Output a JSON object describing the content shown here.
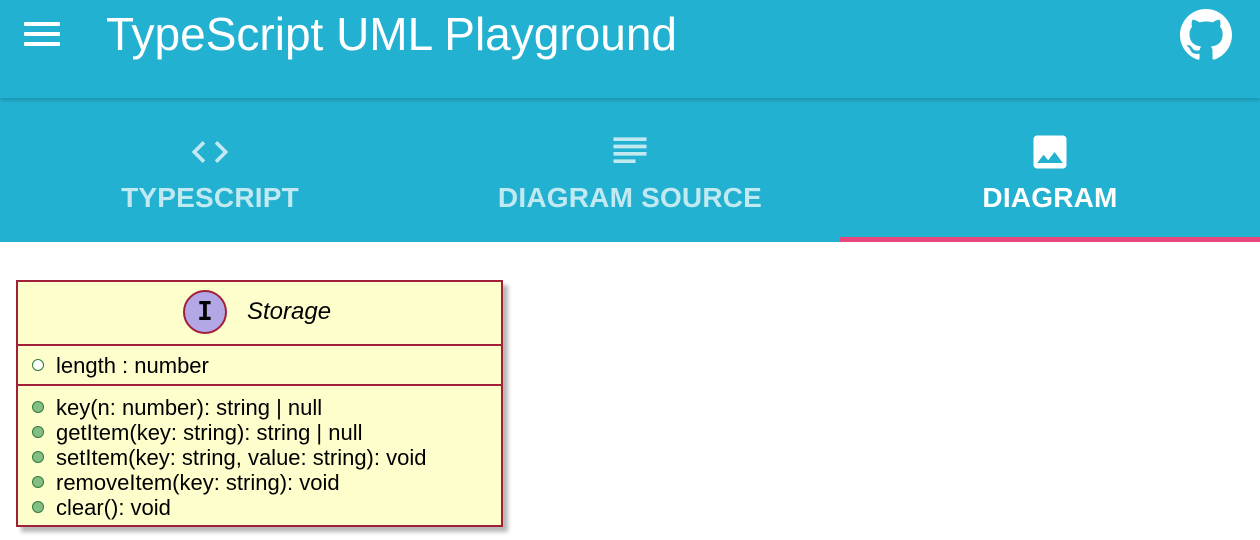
{
  "app": {
    "title": "TypeScript UML Playground",
    "menu_icon": "hamburger-menu-icon",
    "github_icon": "github-icon",
    "accent_color": "#22b1d0",
    "indicator_color": "#e8477d"
  },
  "tabs": [
    {
      "label": "TYPESCRIPT",
      "icon": "code-icon",
      "active": false
    },
    {
      "label": "DIAGRAM SOURCE",
      "icon": "notes-icon",
      "active": false
    },
    {
      "label": "DIAGRAM",
      "icon": "image-icon",
      "active": true
    }
  ],
  "diagram": {
    "class_name": "Storage",
    "stereotype_letter": "I",
    "box_fill": "#fefecd",
    "box_border": "#a0203a",
    "fields": [
      {
        "text": "length : number",
        "marker": "hollow-circle"
      }
    ],
    "methods": [
      {
        "text": "key(n: number): string | null",
        "marker": "filled-circle"
      },
      {
        "text": "getItem(key: string): string | null",
        "marker": "filled-circle"
      },
      {
        "text": "setItem(key: string, value: string): void",
        "marker": "filled-circle"
      },
      {
        "text": "removeItem(key: string): void",
        "marker": "filled-circle"
      },
      {
        "text": "clear(): void",
        "marker": "filled-circle"
      }
    ]
  }
}
